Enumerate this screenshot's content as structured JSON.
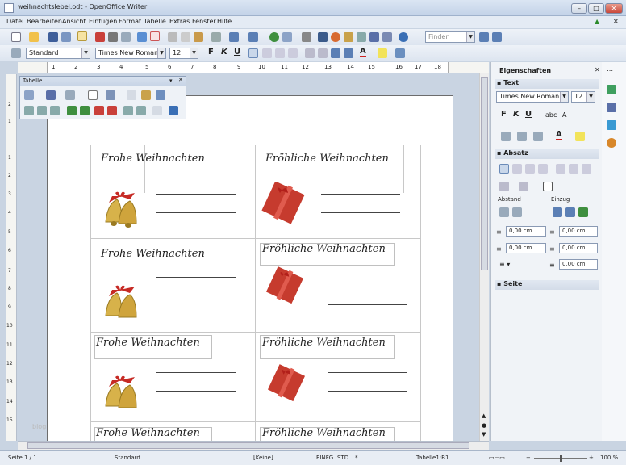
{
  "window": {
    "title": "weihnachtslebel.odt - OpenOffice Writer"
  },
  "menu": [
    "Datei",
    "Bearbeiten",
    "Ansicht",
    "Einfügen",
    "Format",
    "Tabelle",
    "Extras",
    "Fenster",
    "Hilfe"
  ],
  "toolbar": {
    "find_placeholder": "Finden",
    "style": "Standard",
    "font": "Times New Roman",
    "size": "12"
  },
  "ruler": {
    "h_ticks": [
      "1",
      "2",
      "3",
      "4",
      "5",
      "6",
      "7",
      "8",
      "9",
      "10",
      "11",
      "12",
      "13",
      "14",
      "15",
      "16",
      "17",
      "18"
    ],
    "v_ticks": [
      "2",
      "1",
      "1",
      "2",
      "3",
      "4",
      "5",
      "6",
      "7",
      "8",
      "9",
      "10",
      "11",
      "12",
      "13",
      "14",
      "15"
    ]
  },
  "tabelle_panel": {
    "title": "Tabelle"
  },
  "document": {
    "labels": [
      {
        "text": "Frohe Weihnachten"
      },
      {
        "text": "Fröhliche Weihnachten"
      },
      {
        "text": "Frohe Weihnachten"
      },
      {
        "text": "Fröhliche Weihnachten"
      },
      {
        "text": "Frohe Weihnachten"
      },
      {
        "text": "Fröhliche Weihnachten"
      },
      {
        "text": "Frohe Weihnachten"
      },
      {
        "text": "Fröhliche Weihnachten"
      }
    ],
    "watermark": "blog"
  },
  "sidebar": {
    "title": "Eigenschaften",
    "text_section": "Text",
    "font": "Times New Roman",
    "size": "12",
    "absatz_section": "Absatz",
    "abstand": "Abstand",
    "einzug": "Einzug",
    "spins": [
      "0,00 cm",
      "0,00 cm",
      "0,00 cm",
      "0,00 cm",
      "0,00 cm"
    ],
    "seite_section": "Seite"
  },
  "status": {
    "page": "Seite 1 / 1",
    "style": "Standard",
    "lang": "[Keine]",
    "mode1": "EINFG",
    "mode2": "STD",
    "mod": "*",
    "cell": "Tabelle1:B1",
    "zoom": "100 %"
  },
  "colors": {
    "accent": "#3a6fb5",
    "gift": "#c63b2e",
    "bell": "#d7b24a"
  }
}
